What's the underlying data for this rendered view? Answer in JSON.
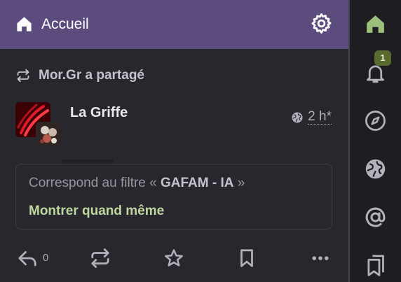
{
  "header": {
    "title": "Accueil",
    "home_icon": "home-icon",
    "settings_icon": "gear-icon"
  },
  "sidebar": {
    "items": [
      {
        "icon": "home-icon",
        "color": "#9cbf7b",
        "active": true
      },
      {
        "icon": "bell-icon",
        "badge": "1"
      },
      {
        "icon": "compass-icon"
      },
      {
        "icon": "globe-icon"
      },
      {
        "icon": "at-icon"
      },
      {
        "icon": "bookmarks-icon"
      }
    ]
  },
  "post": {
    "reblog_text": "Mor.Gr a partagé",
    "author": "La Griffe",
    "visibility_icon": "globe-icon",
    "time": "2 h",
    "edited_marker": "*",
    "filter": {
      "prefix": "Correspond au filtre « ",
      "keyword": "GAFAM - IA",
      "suffix": " »",
      "show_anyway": "Montrer quand même"
    },
    "actions": {
      "reply_count": "0"
    }
  },
  "colors": {
    "header_bg": "#5c4b7d",
    "accent": "#bfd79f",
    "badge_bg": "#596a2e",
    "background": "#28272e"
  }
}
